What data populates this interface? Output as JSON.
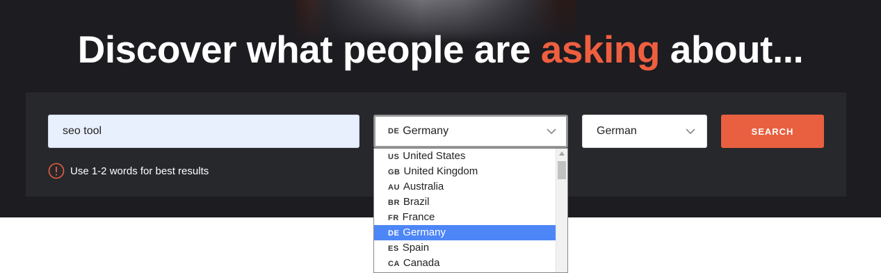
{
  "headline": {
    "before": "Discover what people are ",
    "accent": "asking",
    "after": " about..."
  },
  "search": {
    "value": "seo tool",
    "button_label": "SEARCH"
  },
  "country_select": {
    "selected_code": "DE",
    "selected_label": "Germany"
  },
  "language_select": {
    "selected_label": "German"
  },
  "hint": {
    "text": "Use 1-2 words for best results"
  },
  "country_options": [
    {
      "code": "US",
      "label": "United States"
    },
    {
      "code": "GB",
      "label": "United Kingdom"
    },
    {
      "code": "AU",
      "label": "Australia"
    },
    {
      "code": "BR",
      "label": "Brazil"
    },
    {
      "code": "FR",
      "label": "France"
    },
    {
      "code": "DE",
      "label": "Germany",
      "selected": true
    },
    {
      "code": "ES",
      "label": "Spain"
    },
    {
      "code": "CA",
      "label": "Canada"
    }
  ],
  "colors": {
    "accent": "#ef5f3f",
    "button": "#e8603f",
    "highlight": "#4d86f7"
  }
}
